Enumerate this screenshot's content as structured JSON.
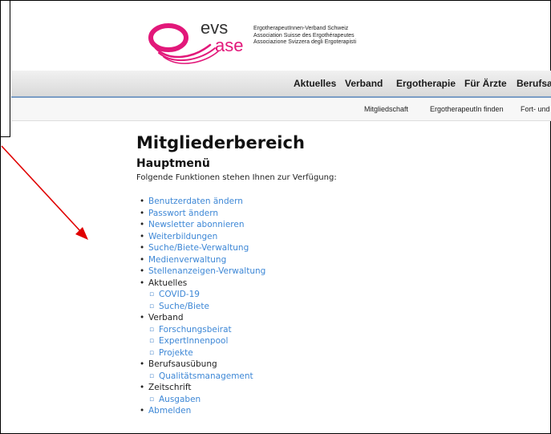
{
  "logo": {
    "brand_top": "evs",
    "brand_bottom": "ase",
    "lines": [
      "ErgotherapeutInnen-Verband Schweiz",
      "Association Suisse des Ergothérapeutes",
      "Associazione Svizzera degli Ergoterapisti"
    ],
    "color_pink": "#e2187a",
    "color_dark": "#333333"
  },
  "main_nav": [
    "Aktuelles",
    "Verband",
    "Ergotherapie",
    "Für Ärzte",
    "Berufsau"
  ],
  "sub_nav": [
    "Mitgliedschaft",
    "ErgotherapeutIn finden",
    "Fort- und"
  ],
  "page": {
    "title": "Mitgliederbereich",
    "subtitle": "Hauptmenü",
    "intro": "Folgende Funktionen stehen Ihnen zur Verfügung:"
  },
  "menu": [
    {
      "label": "Benutzerdaten ändern",
      "level": 1,
      "link": true
    },
    {
      "label": "Passwort ändern",
      "level": 1,
      "link": true
    },
    {
      "label": "Newsletter abonnieren",
      "level": 1,
      "link": true
    },
    {
      "label": "Weiterbildungen",
      "level": 1,
      "link": true
    },
    {
      "label": "Suche/Biete-Verwaltung",
      "level": 1,
      "link": true
    },
    {
      "label": "Medienverwaltung",
      "level": 1,
      "link": true
    },
    {
      "label": "Stellenanzeigen-Verwaltung",
      "level": 1,
      "link": true
    },
    {
      "label": "Aktuelles",
      "level": 1,
      "link": false
    },
    {
      "label": "COVID-19",
      "level": 2,
      "link": true
    },
    {
      "label": "Suche/Biete",
      "level": 2,
      "link": true
    },
    {
      "label": "Verband",
      "level": 1,
      "link": false
    },
    {
      "label": "Forschungsbeirat",
      "level": 2,
      "link": true
    },
    {
      "label": "ExpertInnenpool",
      "level": 2,
      "link": true
    },
    {
      "label": "Projekte",
      "level": 2,
      "link": true
    },
    {
      "label": "Berufsausübung",
      "level": 1,
      "link": false
    },
    {
      "label": "Qualitätsmanagement",
      "level": 2,
      "link": true
    },
    {
      "label": "Zeitschrift",
      "level": 1,
      "link": false
    },
    {
      "label": "Ausgaben",
      "level": 2,
      "link": true
    },
    {
      "label": "Abmelden",
      "level": 1,
      "link": true
    }
  ],
  "colors": {
    "link": "#3d87d6",
    "nav_separator": "#7a9cc5",
    "arrow": "#e00000"
  }
}
